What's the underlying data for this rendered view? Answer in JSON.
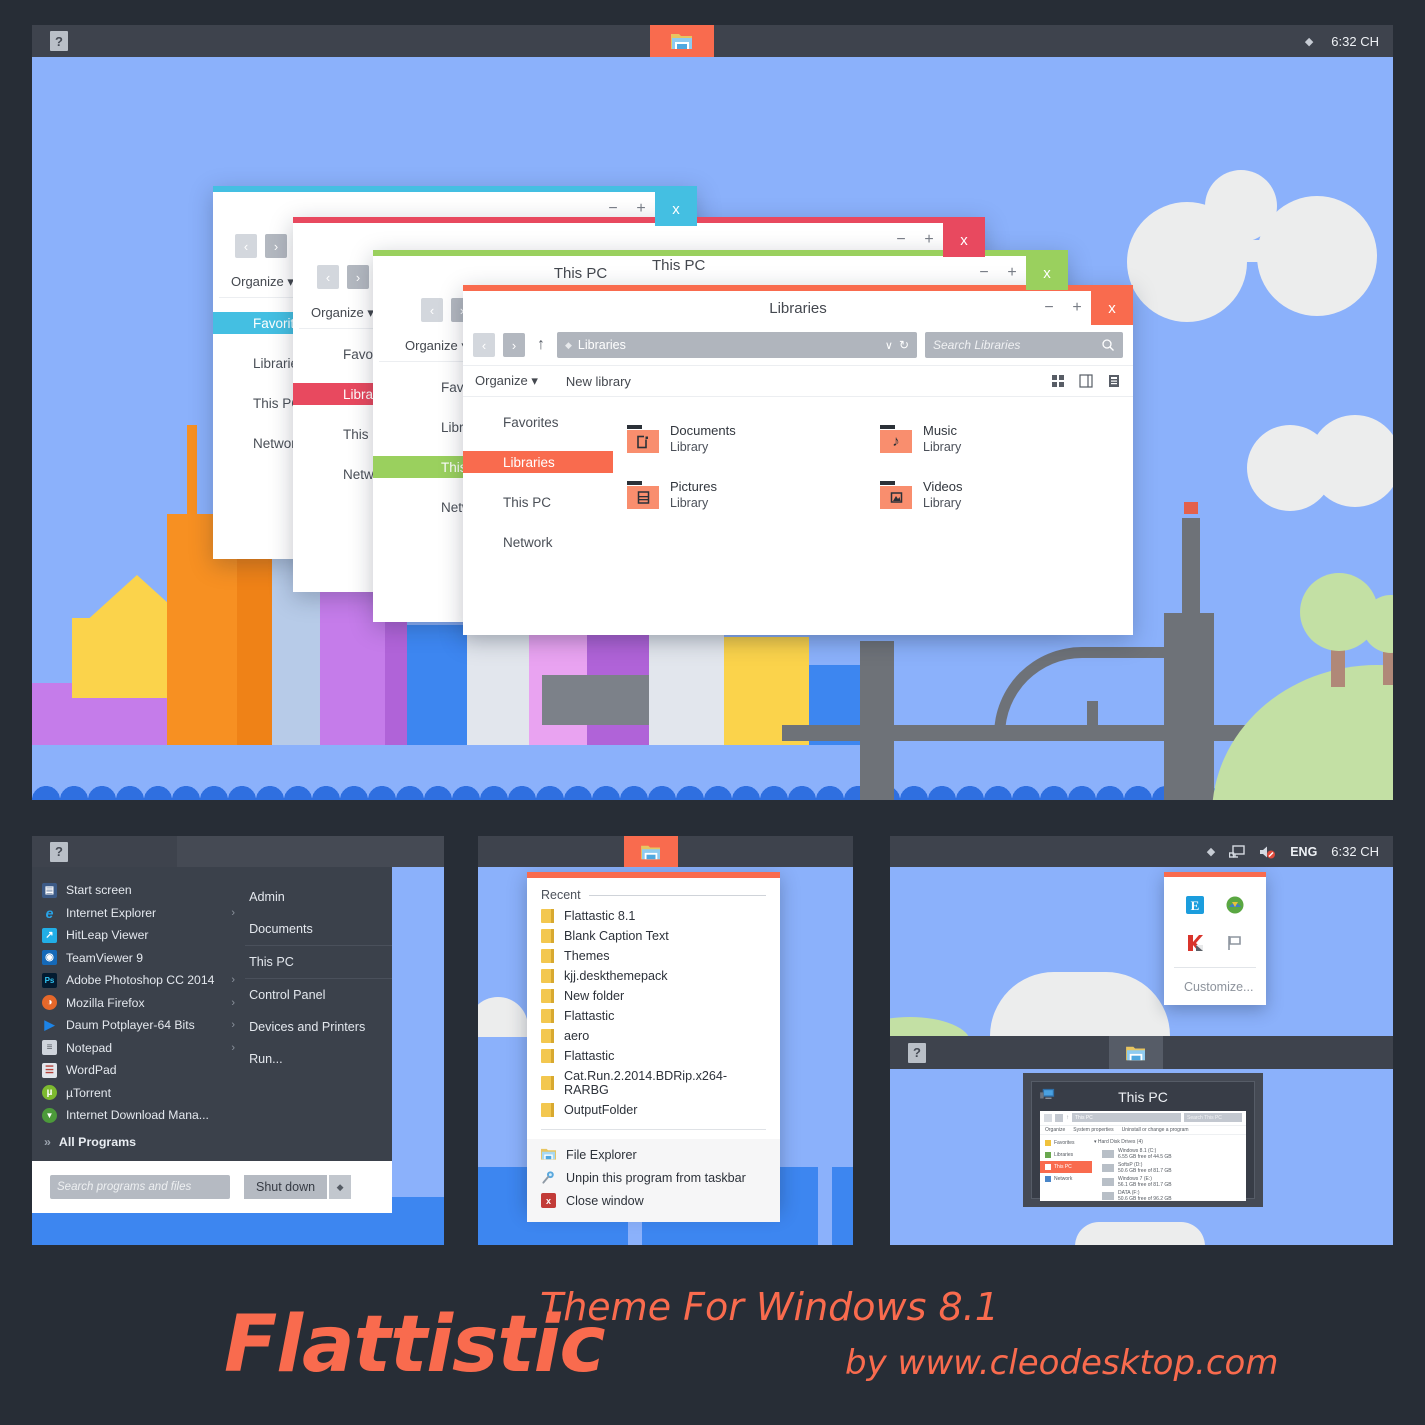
{
  "colors": {
    "page_bg": "#272d36",
    "taskbar": "#454a54",
    "taskbar_segment": "#3e434d",
    "accent_orange": "#f96b4e",
    "accent_cyan": "#44bfe2",
    "accent_red": "#e8495f",
    "accent_green": "#9ad05e",
    "sky": "#8bb1fb",
    "start_menu_bg": "#3b414b"
  },
  "taskbar": {
    "help_icon": "help-icon",
    "explorer_icon": "file-explorer-icon",
    "tray_show_hidden": "◆",
    "clock": "6:32 CH",
    "language": "ENG",
    "network_icon": "network-icon",
    "volume_icon": "volume-muted-icon"
  },
  "windows": [
    {
      "name": "window-cyan",
      "title": "",
      "accent": "#44bfe2",
      "highlight_item": "Favorites",
      "sidebar": [
        "Favorites",
        "Libraries",
        "This PC",
        "Network"
      ],
      "minimize": "−",
      "maximize": "+",
      "close": "x",
      "organize": "Organize"
    },
    {
      "name": "window-red",
      "title": "",
      "accent": "#e8495f",
      "highlight_item": "Libraries",
      "sidebar": [
        "Favorites",
        "Libraries",
        "This PC",
        "Network"
      ],
      "minimize": "−",
      "maximize": "+",
      "close": "x",
      "organize": "Organize"
    },
    {
      "name": "window-green",
      "title": "This PC",
      "accent": "#9ad05e",
      "highlight_item": "This PC",
      "sidebar": [
        "Favorites",
        "Libraries",
        "This PC",
        "Network"
      ],
      "minimize": "−",
      "maximize": "+",
      "close": "x",
      "organize": "Organize"
    }
  ],
  "main_window": {
    "title": "Libraries",
    "accent": "#f96b4e",
    "minimize": "−",
    "maximize": "+",
    "close": "x",
    "nav": {
      "back": "‹",
      "forward": "›",
      "up": "↑"
    },
    "address": {
      "value": "Libraries",
      "dropdown": "∨",
      "refresh": "↻"
    },
    "search": {
      "placeholder": "Search Libraries",
      "icon": "search-icon"
    },
    "toolbar": {
      "organize": "Organize",
      "organize_caret": "▾",
      "new_library": "New library",
      "view_tiles": "tiles-view-icon",
      "view_pane": "preview-pane-icon",
      "view_details": "details-pane-icon"
    },
    "sidebar": [
      {
        "label": "Favorites",
        "selected": false
      },
      {
        "label": "Libraries",
        "selected": true
      },
      {
        "label": "This PC",
        "selected": false
      },
      {
        "label": "Network",
        "selected": false
      }
    ],
    "items": [
      {
        "name": "Documents",
        "sub": "Library",
        "icon": "documents-library-icon"
      },
      {
        "name": "Music",
        "sub": "Library",
        "icon": "music-library-icon"
      },
      {
        "name": "Pictures",
        "sub": "Library",
        "icon": "pictures-library-icon"
      },
      {
        "name": "Videos",
        "sub": "Library",
        "icon": "videos-library-icon"
      }
    ]
  },
  "start_menu": {
    "programs": [
      {
        "label": "Start screen",
        "icon": "start-screen-icon",
        "color": "#3c5a86",
        "glyph": "▦",
        "arrow": false
      },
      {
        "label": "Internet Explorer",
        "icon": "internet-explorer-icon",
        "color": "#1b7ed6",
        "glyph": "e",
        "arrow": true
      },
      {
        "label": "HitLeap Viewer",
        "icon": "hitleap-viewer-icon",
        "color": "#21aee6",
        "glyph": "↗",
        "arrow": false
      },
      {
        "label": "TeamViewer 9",
        "icon": "teamviewer-icon",
        "color": "#1569b8",
        "glyph": "●",
        "arrow": false
      },
      {
        "label": "Adobe Photoshop CC 2014",
        "icon": "photoshop-icon",
        "color": "#031b30",
        "glyph": "Ps",
        "arrow": true
      },
      {
        "label": "Mozilla Firefox",
        "icon": "firefox-icon",
        "color": "#e6682a",
        "glyph": "◔",
        "arrow": true
      },
      {
        "label": "Daum Potplayer-64 Bits",
        "icon": "potplayer-icon",
        "color": "#1c84e8",
        "glyph": "▶",
        "arrow": true
      },
      {
        "label": "Notepad",
        "icon": "notepad-icon",
        "color": "#cfd4dc",
        "glyph": "≡",
        "arrow": true
      },
      {
        "label": "WordPad",
        "icon": "wordpad-icon",
        "color": "#e2e6ec",
        "glyph": "☷",
        "arrow": false
      },
      {
        "label": "µTorrent",
        "icon": "utorrent-icon",
        "color": "#7dba2f",
        "glyph": "µ",
        "arrow": false
      },
      {
        "label": "Internet Download Mana...",
        "icon": "idm-icon",
        "color": "#4c9a3a",
        "glyph": "▼",
        "arrow": false
      }
    ],
    "all_programs": "All Programs",
    "all_programs_icon": "chevron-double-right-icon",
    "right_items": [
      "Admin",
      "Documents",
      "This PC",
      "Control Panel",
      "Devices and Printers",
      "Run..."
    ],
    "search_placeholder": "Search programs and files",
    "shutdown": "Shut down",
    "shutdown_caret": "◆"
  },
  "jump_list": {
    "header": "Recent",
    "recent": [
      "Flattastic 8.1",
      "Blank Caption Text",
      "Themes",
      "kjj.deskthemepack",
      "New folder",
      "Flattastic",
      "aero",
      "Flattastic",
      "Cat.Run.2.2014.BDRip.x264-RARBG",
      "OutputFolder"
    ],
    "actions": [
      {
        "label": "File Explorer",
        "icon": "file-explorer-icon",
        "color": "#e7c75c",
        "glyph": "▃"
      },
      {
        "label": "Unpin this program from taskbar",
        "icon": "unpin-icon",
        "color": "#5aa8dd",
        "glyph": "⚓"
      },
      {
        "label": "Close window",
        "icon": "close-window-icon",
        "color": "#c23b38",
        "glyph": "x"
      }
    ]
  },
  "tray_flyout": {
    "icons": [
      {
        "name": "internet-explorer-tray-icon",
        "color": "#1b9ddd",
        "glyph": "e"
      },
      {
        "name": "idm-tray-icon",
        "color": "#4c9a3a",
        "glyph": "▼"
      },
      {
        "name": "kaspersky-tray-icon",
        "color": "#d9342b",
        "glyph": "K"
      },
      {
        "name": "action-center-flag-icon",
        "color": "#8e959f",
        "glyph": "⚑"
      }
    ],
    "customize": "Customize..."
  },
  "thumbnail": {
    "title": "This PC",
    "icon": "this-pc-icon",
    "shot": {
      "address": "This PC",
      "search": "Search This PC",
      "toolbar": [
        "Organize",
        "System properties",
        "Uninstall or change a program"
      ],
      "sidebar": [
        "Favorites",
        "Libraries",
        "This PC",
        "Network"
      ],
      "group": "Hard Disk Drives (4)",
      "drives": [
        {
          "name": "Windows 8.1 (C:)",
          "free": "6.55 GB free of 44.5 GB"
        },
        {
          "name": "SoftsP (D:)",
          "free": "50.6 GB free of 81.7 GB"
        },
        {
          "name": "Windows 7 (E:)",
          "free": "56.1 GB free of 81.7 GB"
        },
        {
          "name": "DATA (F:)",
          "free": "50.6 GB free of 96.2 GB"
        }
      ]
    }
  },
  "brand": {
    "name": "Flattistic",
    "tagline": "Theme For Windows 8.1",
    "credit": "by www.cleodesktop.com"
  }
}
